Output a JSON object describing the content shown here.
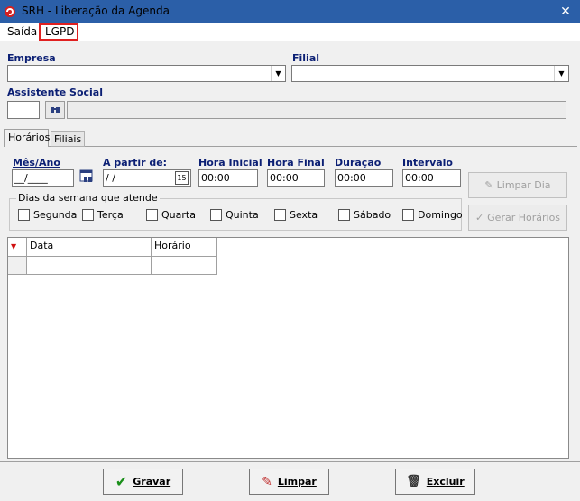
{
  "window": {
    "title": "SRH - Liberação da Agenda",
    "close_glyph": "✕"
  },
  "menu": {
    "items": [
      "Saída",
      "LGPD"
    ]
  },
  "form": {
    "empresa_label": "Empresa",
    "filial_label": "Filial",
    "assistente_label": "Assistente Social",
    "empresa_value": "",
    "filial_value": "",
    "assistente_code": ""
  },
  "tabs": [
    "Horários",
    "Filiais"
  ],
  "horarios": {
    "mes_ano_label": "Mês/Ano",
    "mes_ano_value": "__/____",
    "a_partir_label": "A partir de:",
    "a_partir_value": " / /",
    "calendar_text": "15",
    "hora_inicial_label": "Hora Inicial",
    "hora_inicial_value": "00:00",
    "hora_final_label": "Hora Final",
    "hora_final_value": "00:00",
    "duracao_label": "Duração",
    "duracao_value": "00:00",
    "intervalo_label": "Intervalo",
    "intervalo_value": "00:00",
    "dias_label": "Dias da semana que atende",
    "dias": [
      "Segunda",
      "Terça",
      "Quarta",
      "Quinta",
      "Sexta",
      "Sábado",
      "Domingo"
    ],
    "limpar_dia": "Limpar Dia",
    "gerar_horarios": "Gerar Horários"
  },
  "grid": {
    "columns": [
      "Data",
      "Horário"
    ]
  },
  "buttons": {
    "gravar": "Gravar",
    "limpar": "Limpar",
    "excluir": "Excluir"
  },
  "colors": {
    "titlebar": "#2b5fa8",
    "label_blue": "#0b1f74",
    "highlight_red": "#e02020"
  }
}
